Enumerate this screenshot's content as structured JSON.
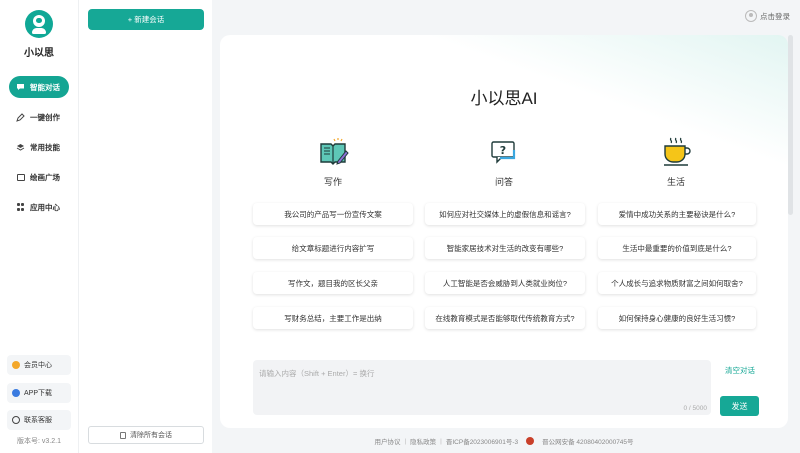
{
  "brand": {
    "name": "小以思"
  },
  "nav": {
    "items": [
      {
        "label": "智能对话",
        "icon": "chat-bubble-icon",
        "active": true
      },
      {
        "label": "一键创作",
        "icon": "pen-icon",
        "active": false
      },
      {
        "label": "常用技能",
        "icon": "layers-icon",
        "active": false
      },
      {
        "label": "绘画广场",
        "icon": "picture-icon",
        "active": false
      },
      {
        "label": "应用中心",
        "icon": "grid-apps-icon",
        "active": false
      }
    ],
    "bottom": [
      {
        "label": "会员中心",
        "icon": "crown-icon",
        "color": "#f3a72a"
      },
      {
        "label": "APP下载",
        "icon": "cloud-download-icon",
        "color": "#3a7be0"
      },
      {
        "label": "联系客服",
        "icon": "headset-icon",
        "color": "#444444"
      }
    ],
    "version": "版本号: v3.2.1"
  },
  "conversations": {
    "new_chat_label": "+ 新建会话",
    "clear_all_label": "清除所有会话"
  },
  "header": {
    "login_label": "点击登录"
  },
  "main": {
    "title": "小以思AI",
    "columns": [
      {
        "label": "写作",
        "icon": "book-pencil-icon",
        "questions": [
          "我公司的产品写一份宣传文案",
          "给文章标题进行内容扩写",
          "写作文，题目我的区长父亲",
          "写财务总结，主要工作是出纳"
        ]
      },
      {
        "label": "问答",
        "icon": "question-bubble-icon",
        "questions": [
          "如何应对社交媒体上的虚假信息和谣言?",
          "智能家居技术对生活的改变有哪些?",
          "人工智能是否会威胁到人类就业岗位?",
          "在线教育模式是否能够取代传统教育方式?"
        ]
      },
      {
        "label": "生活",
        "icon": "coffee-cup-icon",
        "questions": [
          "爱情中成功关系的主要秘诀是什么?",
          "生活中最重要的价值到底是什么?",
          "个人成长与追求物质财富之间如何取舍?",
          "如何保持身心健康的良好生活习惯?"
        ]
      }
    ],
    "input": {
      "placeholder": "请输入内容（Shift + Enter）= 换行",
      "counter": "0 / 5000"
    },
    "clear_chat_label": "清空对话",
    "send_label": "发送"
  },
  "footer": {
    "user_agreement": "用户协议",
    "privacy": "隐私政策",
    "icp": "晋ICP备2023006901号-3",
    "police": "晋公网安备 42080402000745号"
  },
  "colors": {
    "accent": "#16a896"
  }
}
